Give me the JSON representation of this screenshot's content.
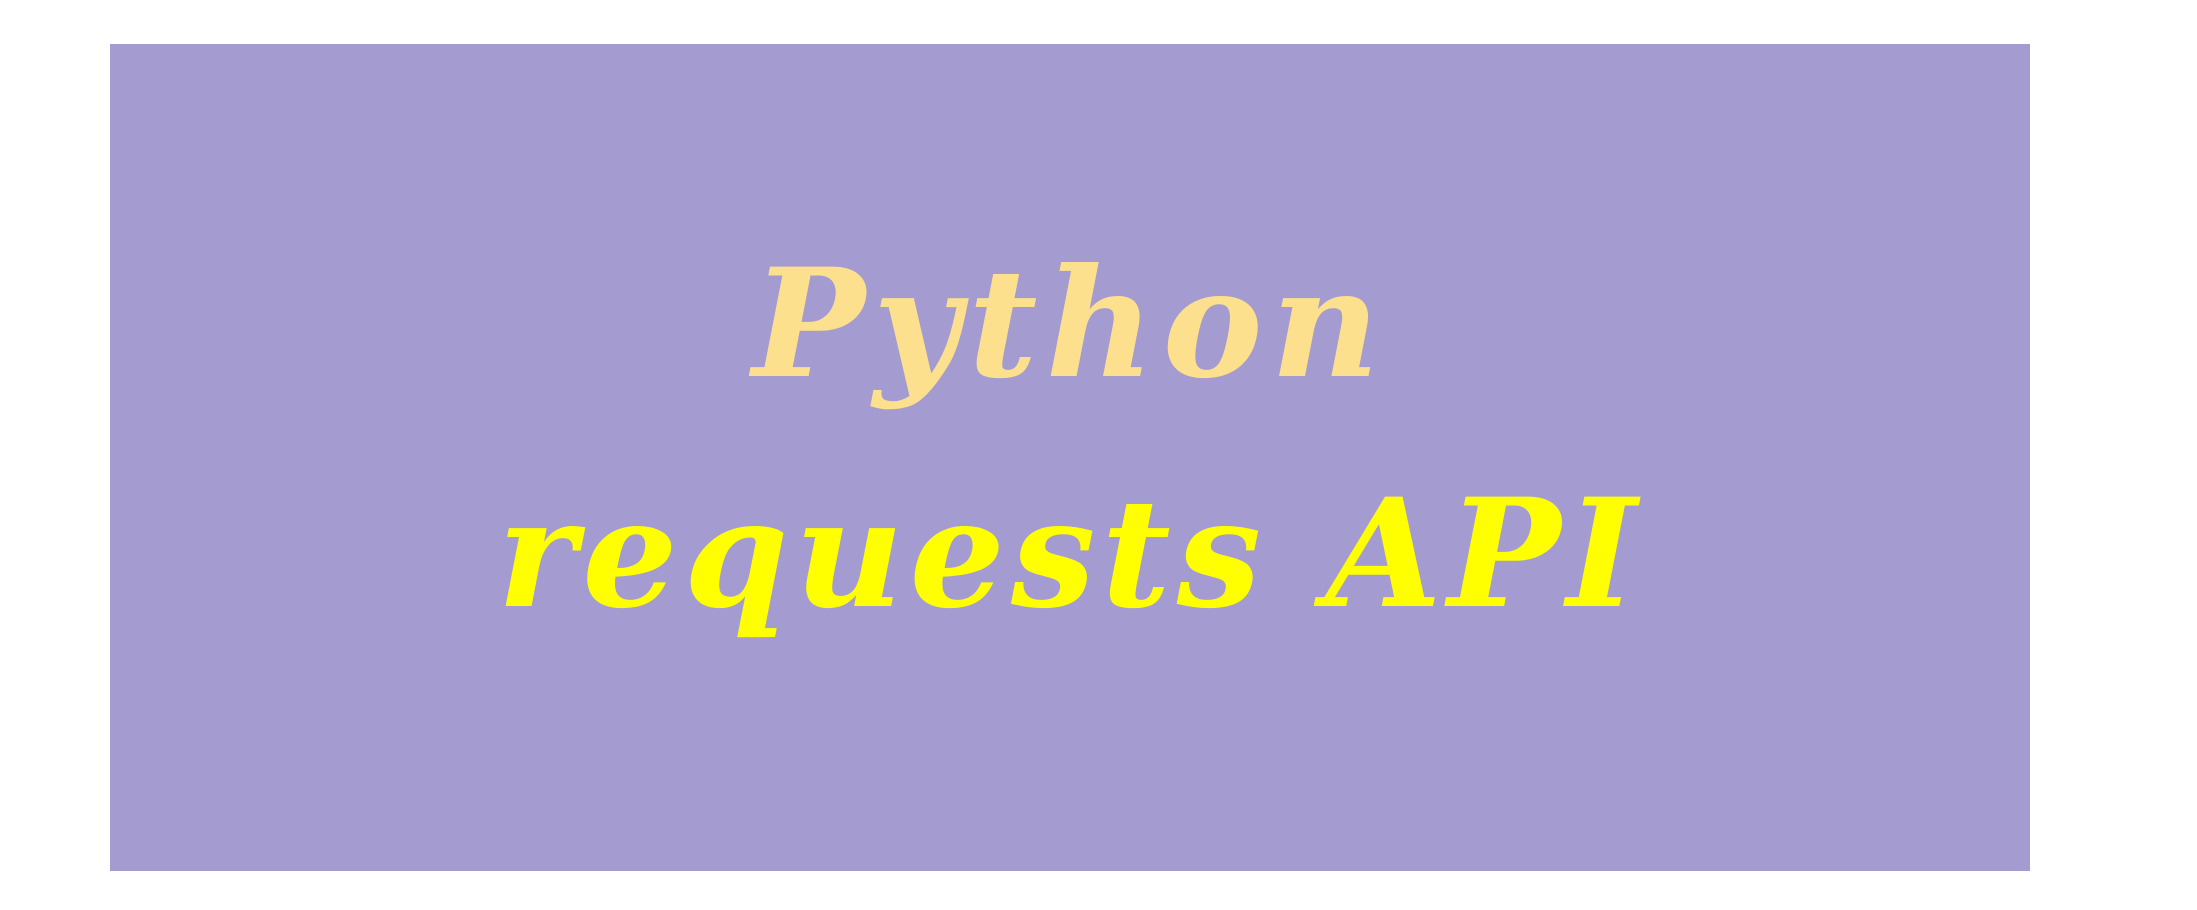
{
  "banner": {
    "title_line_1": "Python",
    "title_line_2": "requests API",
    "colors": {
      "background": "#a49cd0",
      "line_1_text": "#fde08e",
      "line_2_text": "#ffff00",
      "page": "#ffffff"
    }
  }
}
